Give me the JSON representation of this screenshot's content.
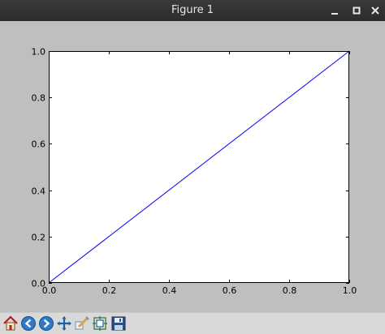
{
  "window": {
    "title": "Figure 1",
    "controls": [
      "minimize-icon",
      "maximize-icon",
      "close-icon"
    ]
  },
  "toolbar": {
    "buttons": [
      {
        "name": "home-button",
        "icon": "home-icon"
      },
      {
        "name": "back-button",
        "icon": "back-arrow-icon"
      },
      {
        "name": "forward-button",
        "icon": "forward-arrow-icon"
      },
      {
        "name": "pan-button",
        "icon": "pan-cross-icon"
      },
      {
        "name": "zoom-button",
        "icon": "zoom-rect-icon"
      },
      {
        "name": "subplots-button",
        "icon": "subplots-config-icon"
      },
      {
        "name": "save-button",
        "icon": "floppy-disk-icon"
      }
    ]
  },
  "chart_data": {
    "type": "line",
    "title": "",
    "xlabel": "",
    "ylabel": "",
    "xlim": [
      0.0,
      1.0
    ],
    "ylim": [
      0.0,
      1.0
    ],
    "xticks": [
      "0.0",
      "0.2",
      "0.4",
      "0.6",
      "0.8",
      "1.0"
    ],
    "yticks": [
      "0.0",
      "0.2",
      "0.4",
      "0.6",
      "0.8",
      "1.0"
    ],
    "grid": false,
    "series": [
      {
        "x": [
          0.0,
          1.0
        ],
        "y": [
          0.0,
          1.0
        ],
        "color": "#0000ff"
      }
    ]
  },
  "colors": {
    "figure_bg": "#bfbfbf",
    "axes_bg": "#ffffff",
    "line": "#0000ff",
    "titlebar": "#2d2d2d"
  }
}
